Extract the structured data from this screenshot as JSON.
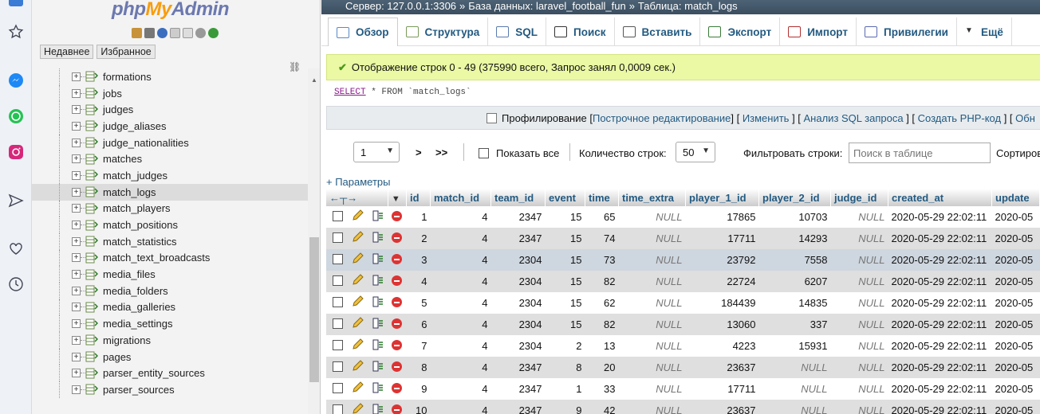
{
  "nav": {
    "logo_php": "php",
    "logo_my": "My",
    "logo_admin": "Admin",
    "tab_recent": "Недавнее",
    "tab_favorites": "Избранное",
    "tables": [
      "formations",
      "jobs",
      "judges",
      "judge_aliases",
      "judge_nationalities",
      "matches",
      "match_judges",
      "match_logs",
      "match_players",
      "match_positions",
      "match_statistics",
      "match_text_broadcasts",
      "media_files",
      "media_folders",
      "media_galleries",
      "media_settings",
      "migrations",
      "pages",
      "parser_entity_sources",
      "parser_sources"
    ],
    "active_table": "match_logs"
  },
  "breadcrumb": {
    "server": "Сервер: 127.0.0.1:3306",
    "database": "База данных: laravel_football_fun",
    "table": "Таблица: match_logs",
    "separator": "»"
  },
  "tabs": [
    "Обзор",
    "Структура",
    "SQL",
    "Поиск",
    "Вставить",
    "Экспорт",
    "Импорт",
    "Привилегии",
    "Ещё"
  ],
  "success_message": "Отображение строк 0 - 49 (375990 всего, Запрос занял 0,0009 сек.)",
  "sql_query": {
    "select": "SELECT",
    "rest": " * FROM `match_logs`"
  },
  "sqlbar": {
    "profiling": "Профилирование",
    "links": [
      "Построчное редактирование",
      "Изменить",
      "Анализ SQL запроса",
      "Создать PHP-код",
      "Обн"
    ]
  },
  "controls": {
    "page": "1",
    "next": ">",
    "last": ">>",
    "show_all": "Показать все",
    "row_count_label": "Количество строк:",
    "row_count": "50",
    "filter_label": "Фильтровать строки:",
    "filter_placeholder": "Поиск в таблице",
    "sort_label": "Сортиров"
  },
  "params": "+ Параметры",
  "columns": [
    "id",
    "match_id",
    "team_id",
    "event",
    "time",
    "time_extra",
    "player_1_id",
    "player_2_id",
    "judge_id",
    "created_at",
    "update"
  ],
  "rows": [
    [
      "1",
      "4",
      "2347",
      "15",
      "65",
      "NULL",
      "17865",
      "10703",
      "NULL",
      "2020-05-29 22:02:11",
      "2020-05"
    ],
    [
      "2",
      "4",
      "2347",
      "15",
      "74",
      "NULL",
      "17711",
      "14293",
      "NULL",
      "2020-05-29 22:02:11",
      "2020-05"
    ],
    [
      "3",
      "4",
      "2304",
      "15",
      "73",
      "NULL",
      "23792",
      "7558",
      "NULL",
      "2020-05-29 22:02:11",
      "2020-05"
    ],
    [
      "4",
      "4",
      "2304",
      "15",
      "82",
      "NULL",
      "22724",
      "6207",
      "NULL",
      "2020-05-29 22:02:11",
      "2020-05"
    ],
    [
      "5",
      "4",
      "2304",
      "15",
      "62",
      "NULL",
      "184439",
      "14835",
      "NULL",
      "2020-05-29 22:02:11",
      "2020-05"
    ],
    [
      "6",
      "4",
      "2304",
      "15",
      "82",
      "NULL",
      "13060",
      "337",
      "NULL",
      "2020-05-29 22:02:11",
      "2020-05"
    ],
    [
      "7",
      "4",
      "2304",
      "2",
      "13",
      "NULL",
      "4223",
      "15931",
      "NULL",
      "2020-05-29 22:02:11",
      "2020-05"
    ],
    [
      "8",
      "4",
      "2347",
      "8",
      "20",
      "NULL",
      "23637",
      "NULL",
      "NULL",
      "2020-05-29 22:02:11",
      "2020-05"
    ],
    [
      "9",
      "4",
      "2347",
      "1",
      "33",
      "NULL",
      "17711",
      "NULL",
      "NULL",
      "2020-05-29 22:02:11",
      "2020-05"
    ],
    [
      "10",
      "4",
      "2347",
      "9",
      "42",
      "NULL",
      "23637",
      "NULL",
      "NULL",
      "2020-05-29 22:02:11",
      "2020-05"
    ]
  ],
  "highlighted_row": 2
}
